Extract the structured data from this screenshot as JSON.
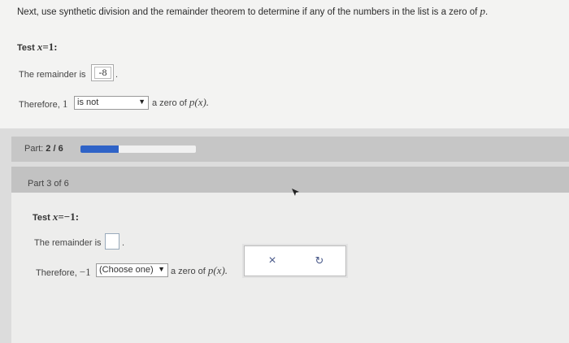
{
  "instruction": {
    "text": "Next, use synthetic division and the remainder theorem to determine if any of the numbers in the list is a zero of",
    "var": "p",
    "period": "."
  },
  "part1": {
    "test_label": "Test",
    "test_var": "x",
    "test_eq": "=",
    "test_value": "1",
    "test_colon": ":",
    "remainder_label": "The remainder is",
    "remainder_value": "-8",
    "therefore_label": "Therefore,",
    "therefore_number": "1",
    "select_value": "is not",
    "zero_text": "a zero of",
    "poly": "p(x)."
  },
  "part2": {
    "label": "Part:",
    "progress_text": "2 / 6",
    "progress_fraction": 0.333
  },
  "part3": {
    "header": "Part 3 of 6",
    "test_label": "Test",
    "test_var": "x",
    "test_eq": "=",
    "test_value": "−1",
    "test_colon": ":",
    "remainder_label": "The remainder is",
    "remainder_value": "",
    "therefore_label": "Therefore,",
    "therefore_number": "−1",
    "select_value": "(Choose one)",
    "zero_text": "a zero of",
    "poly": "p(x)."
  },
  "actions": {
    "clear_glyph": "×",
    "undo_glyph": "↻"
  },
  "icons": {
    "dropdown": "dropdown-arrow-icon",
    "clear": "close-icon",
    "undo": "undo-icon",
    "cursor": "mouse-cursor-icon"
  },
  "colors": {
    "progress_fill": "#2f63c7",
    "action_icon": "#4a5a8a"
  }
}
